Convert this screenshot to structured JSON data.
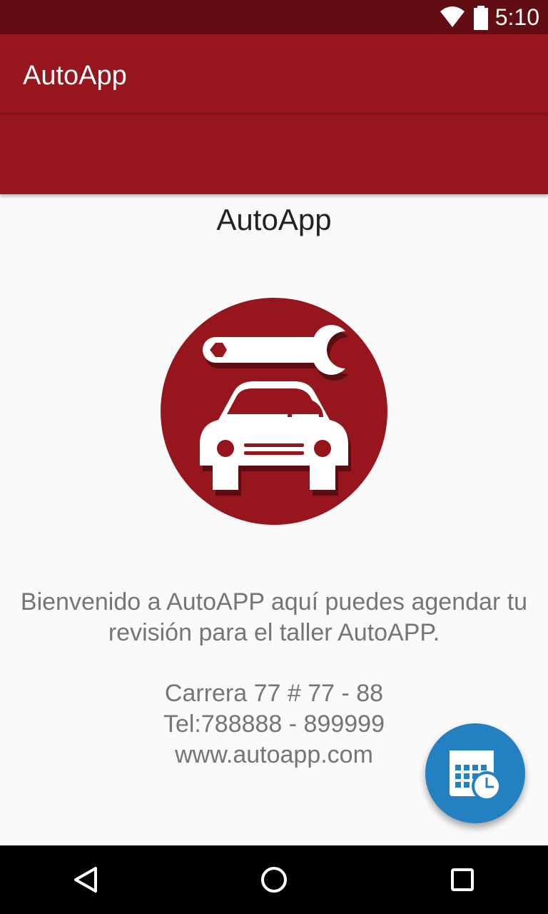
{
  "status_bar": {
    "time": "5:10",
    "wifi_icon": "wifi-icon",
    "battery_icon": "battery-icon"
  },
  "app_bar": {
    "title": "AutoApp",
    "color": "#97151d"
  },
  "main": {
    "heading": "AutoApp",
    "logo_icon": "car-wrench-logo",
    "welcome_text": "Bienvenido a AutoAPP aquí puedes agendar tu revisión para el taller AutoAPP.",
    "address": "Carrera 77 # 77 - 88",
    "phone": "Tel:788888 - 899999",
    "website": "www.autoapp.com"
  },
  "fab": {
    "icon": "calendar-clock-icon",
    "color": "#2481c1"
  },
  "nav_bar": {
    "back_icon": "back-icon",
    "home_icon": "home-icon",
    "recents_icon": "recents-icon"
  }
}
